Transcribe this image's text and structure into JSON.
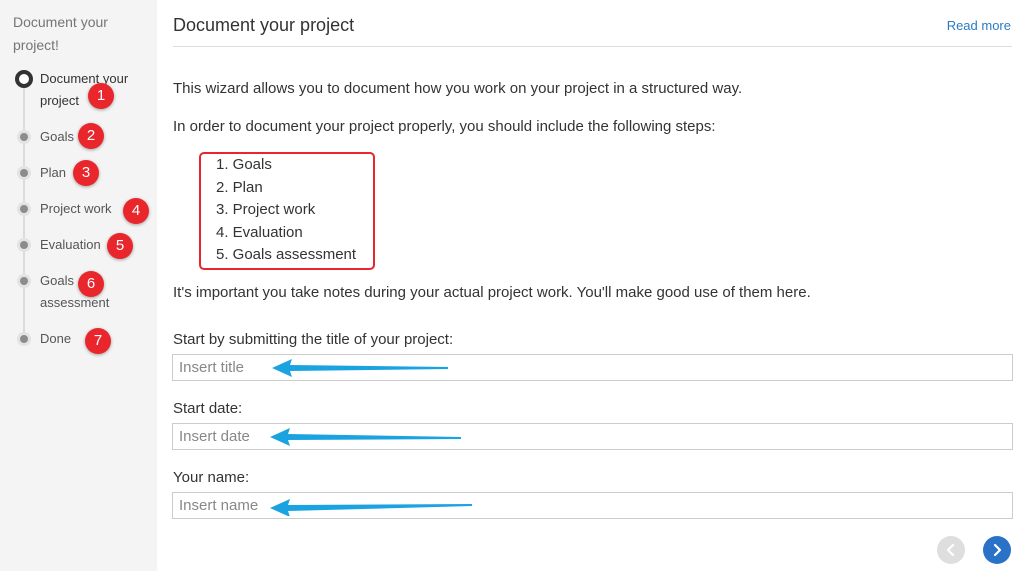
{
  "sidebar": {
    "title": "Document your project!",
    "steps": [
      {
        "label": "Document your project",
        "badge": "1",
        "active": true
      },
      {
        "label": "Goals",
        "badge": "2"
      },
      {
        "label": "Plan",
        "badge": "3"
      },
      {
        "label": "Project work",
        "badge": "4"
      },
      {
        "label": "Evaluation",
        "badge": "5"
      },
      {
        "label": "Goals assessment",
        "badge": "6"
      },
      {
        "label": "Done",
        "badge": "7"
      }
    ]
  },
  "header": {
    "title": "Document your project",
    "read_more": "Read more"
  },
  "main": {
    "intro": "This wizard allows you to document how you work on your project in a structured way.",
    "instructions": "In order to document your project properly, you should include the following steps:",
    "steps_list": [
      "1. Goals",
      "2. Plan",
      "3. Project work",
      "4. Evaluation",
      "5. Goals assessment"
    ],
    "notes": "It's important you take notes during your actual project work. You'll make good use of them here.",
    "fields": {
      "title": {
        "label": "Start by submitting the title of your project:",
        "placeholder": "Insert title",
        "value": ""
      },
      "date": {
        "label": "Start date:",
        "placeholder": "Insert date",
        "value": ""
      },
      "name": {
        "label": "Your name:",
        "placeholder": "Insert name",
        "value": ""
      }
    }
  },
  "nav": {
    "prev_icon": "chevron-left-icon",
    "next_icon": "chevron-right-icon"
  },
  "colors": {
    "badge": "#e8262b",
    "annotation_arrow": "#1aa3e0",
    "link": "#2b7bc4",
    "next_button": "#2a72c8"
  }
}
